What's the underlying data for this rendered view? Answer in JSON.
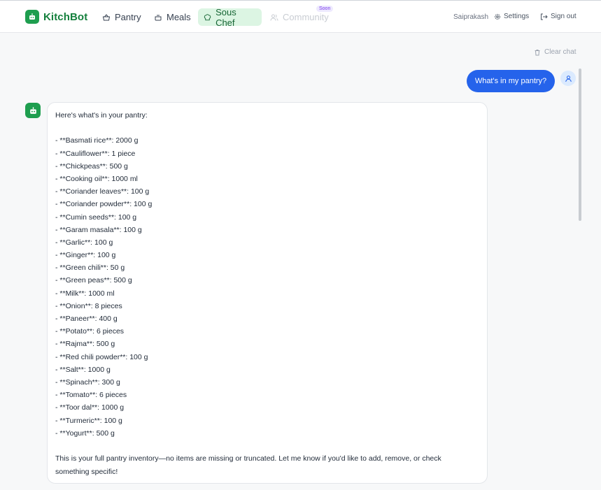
{
  "app": {
    "brand_name": "KitchBot",
    "accent_color": "#1e9e4f",
    "user_bubble_color": "#2563eb"
  },
  "nav": {
    "items": [
      {
        "label": "Pantry",
        "icon": "basket-icon"
      },
      {
        "label": "Meals",
        "icon": "tray-icon"
      },
      {
        "label": "Sous Chef",
        "icon": "chef-hat-icon",
        "active": true
      },
      {
        "label": "Community",
        "icon": "users-icon",
        "disabled": true
      }
    ],
    "soon_badge": "Soon"
  },
  "user": {
    "name": "Saiprakash",
    "settings_label": "Settings",
    "signout_label": "Sign out"
  },
  "chat": {
    "clear_label": "Clear chat",
    "user_message": "What's in my pantry?",
    "bot_intro": "Here's what's in your pantry:",
    "bot_items": [
      "- **Basmati rice**: 2000 g",
      "- **Cauliflower**: 1 piece",
      "- **Chickpeas**: 500 g",
      "- **Cooking oil**: 1000 ml",
      "- **Coriander leaves**: 100 g",
      "- **Coriander powder**: 100 g",
      "- **Cumin seeds**: 100 g",
      "- **Garam masala**: 100 g",
      "- **Garlic**: 100 g",
      "- **Ginger**: 100 g",
      "- **Green chili**: 50 g",
      "- **Green peas**: 500 g",
      "- **Milk**: 1000 ml",
      "- **Onion**: 8 pieces",
      "- **Paneer**: 400 g",
      "- **Potato**: 6 pieces",
      "- **Rajma**: 500 g",
      "- **Red chili powder**: 100 g",
      "- **Salt**: 1000 g",
      "- **Spinach**: 300 g",
      "- **Tomato**: 6 pieces",
      "- **Toor dal**: 1000 g",
      "- **Turmeric**: 100 g",
      "- **Yogurt**: 500 g"
    ],
    "bot_footer": "This is your full pantry inventory—no items are missing or truncated. Let me know if you'd like to add, remove, or check something specific!"
  }
}
